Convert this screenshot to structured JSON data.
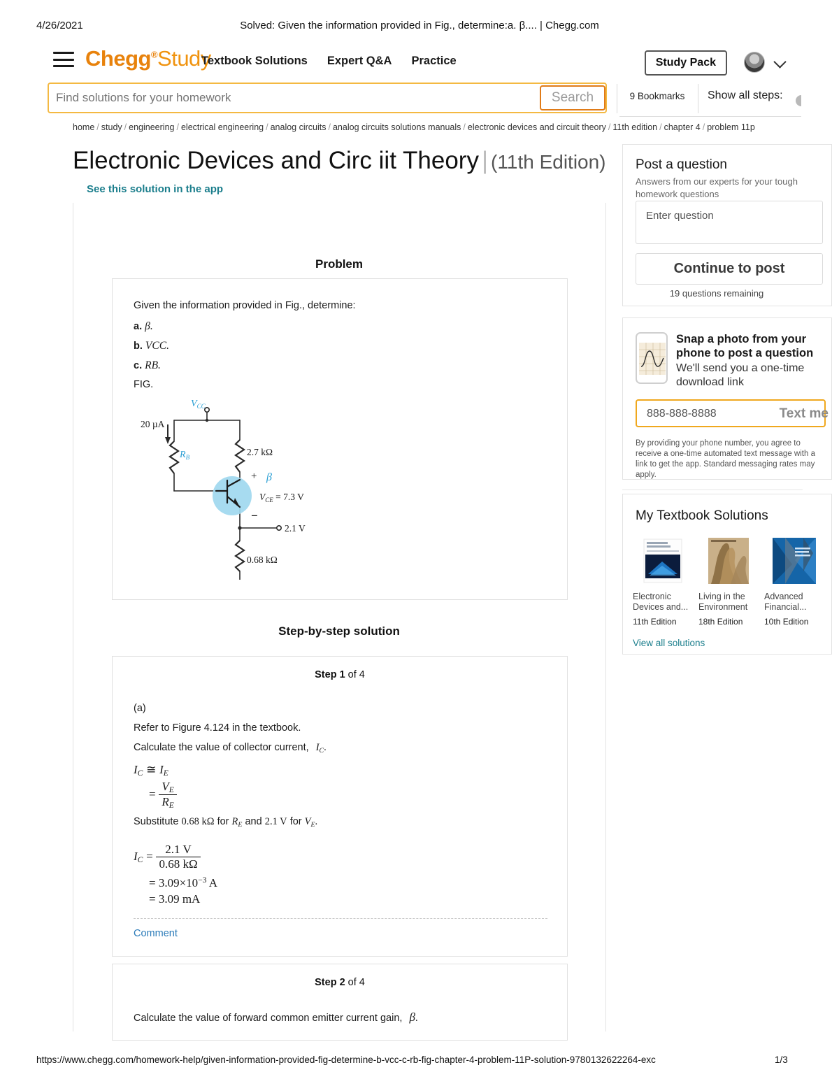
{
  "print": {
    "date": "4/26/2021",
    "doc_title": "Solved: Given the information provided in Fig., determine:a. β.... | Chegg.com",
    "url": "https://www.chegg.com/homework-help/given-information-provided-fig-determine-b-vcc-c-rb-fig-chapter-4-problem-11P-solution-9780132622264-exc",
    "page": "1/3"
  },
  "header": {
    "logo_chegg": "Chegg",
    "logo_reg": "®",
    "logo_study": "Study",
    "nav": [
      {
        "label": "Textbook Solutions"
      },
      {
        "label": "Expert Q&A"
      },
      {
        "label": "Practice"
      }
    ],
    "study_pack": "Study Pack"
  },
  "search": {
    "placeholder": "Find solutions for your homework",
    "value": "",
    "button": "Search",
    "bookmarks": "9 Bookmarks",
    "show_all_steps": "Show all steps:"
  },
  "breadcrumb": [
    "home",
    "study",
    "engineering",
    "electrical engineering",
    "analog circuits",
    "analog circuits solutions manuals",
    "electronic devices and circuit theory",
    "11th edition",
    "chapter 4",
    "problem 11p"
  ],
  "title": {
    "book": "Electronic Devices and Circ iit Theory",
    "separator": "|",
    "edition": "(11th Edition)",
    "app_link": "See this solution in the app"
  },
  "problem": {
    "heading": "Problem",
    "intro": "Given the information provided in Fig., determine:",
    "items": [
      {
        "letter": "a.",
        "text": "β."
      },
      {
        "letter": "b.",
        "text": "VCC."
      },
      {
        "letter": "c.",
        "text": "RB."
      }
    ],
    "fig_label": "FIG."
  },
  "circuit": {
    "vcc": "V",
    "vcc_sub": "CC",
    "current": "20 µA",
    "rb": "R",
    "rb_sub": "B",
    "rc": "2.7 kΩ",
    "re": "0.68 kΩ",
    "beta": "β",
    "vce": "V",
    "vce_sub": "CE",
    "vce_value": "= 7.3 V",
    "ve": "2.1 V",
    "plus": "+",
    "minus": "−"
  },
  "solution": {
    "heading": "Step-by-step solution",
    "step1": {
      "label_prefix": "Step ",
      "number": "1",
      "label_suffix": " of 4",
      "part": "(a)",
      "refer": "Refer to Figure 4.124 in the textbook.",
      "calc_line": "Calculate the value of collector current,",
      "calc_symbol": "I",
      "calc_sub": "C",
      "calc_period": ".",
      "eq_ic": "I",
      "eq_ic_sub": "C",
      "eq_approx": "≅",
      "eq_ie": "I",
      "eq_ie_sub": "E",
      "eq_frac_num": "V",
      "eq_frac_num_sub": "E",
      "eq_frac_den": "R",
      "eq_frac_den_sub": "E",
      "substitute_pre": "Substitute",
      "substitute_re": "0.68 kΩ",
      "substitute_for1": "for",
      "substitute_re_sym": "R",
      "substitute_re_sub": "E",
      "substitute_and": "and",
      "substitute_ve": "2.1 V",
      "substitute_for2": "for",
      "substitute_ve_sym": "V",
      "substitute_ve_sub": "E",
      "result_num": "2.1 V",
      "result_den": "0.68 kΩ",
      "result_sci_a": "= 3.09×10",
      "result_sci_exp": "−3",
      "result_sci_unit": " A",
      "result_ma": "= 3.09 mA",
      "comment": "Comment"
    },
    "step2": {
      "label_prefix": "Step ",
      "number": "2",
      "label_suffix": " of 4",
      "text": "Calculate the value of forward common emitter current gain,",
      "symbol": "β",
      "period": "."
    }
  },
  "sidebar": {
    "post": {
      "heading": "Post a question",
      "sub": "Answers from our experts for your tough homework questions",
      "placeholder": "Enter question",
      "button": "Continue to post",
      "remaining": "19 questions remaining"
    },
    "snap": {
      "heading_l1": "Snap a photo from your",
      "heading_l2": "phone to post a question",
      "sub_l1": "We'll send you a one-time",
      "sub_l2": "download link",
      "phone_value": "888-888-8888",
      "text_me": "Text me",
      "legal": "By providing your phone number, you agree to receive a one-time automated text message with a link to get the app. Standard messaging rates may apply."
    },
    "books": {
      "heading": "My Textbook Solutions",
      "items": [
        {
          "title": "Electronic Devices and...",
          "edition": "11th Edition",
          "cover": "#0b2a5b"
        },
        {
          "title": "Living in the Environment",
          "edition": "18th Edition",
          "cover": "#a98a60"
        },
        {
          "title": "Advanced Financial...",
          "edition": "10th Edition",
          "cover": "#1565a8"
        }
      ],
      "view_all": "View all solutions"
    }
  },
  "colors": {
    "brand_orange": "#e8820c",
    "search_border": "#f4b942",
    "link_teal": "#1b7e8c",
    "comment_blue": "#2b7bb9",
    "transistor_highlight": "#9fd8ef"
  }
}
